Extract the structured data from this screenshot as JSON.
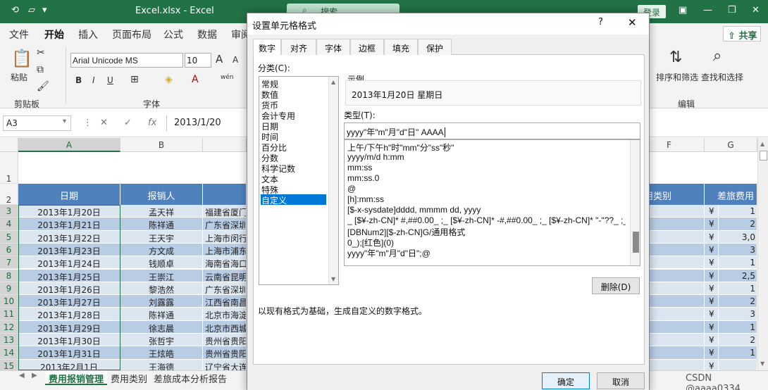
{
  "titlebar": {
    "title": "Excel.xlsx  -  Excel",
    "search_placeholder": "搜索",
    "login_label": "登录",
    "accent_color": "#217346"
  },
  "ribbon": {
    "tabs": [
      "文件",
      "开始",
      "插入",
      "页面布局",
      "公式",
      "数据",
      "审阅"
    ],
    "active_tab": "开始",
    "share_label": "共享",
    "clipboard": {
      "paste_label": "粘贴",
      "group_label": "剪贴板"
    },
    "font": {
      "name": "Arial Unicode MS",
      "size": "10",
      "group_label": "字体",
      "bold": "B",
      "italic": "I",
      "underline": "U",
      "grow": "A",
      "shrink": "A",
      "phonetic": "wén"
    },
    "editing": {
      "sort_label": "排序和筛选",
      "find_label": "查找和选择",
      "group_label": "编辑"
    }
  },
  "formula_bar": {
    "name_box": "A3",
    "fx_label": "fx",
    "formula": "2013/1/20"
  },
  "grid": {
    "columns": [
      "A",
      "B",
      "F",
      "G"
    ],
    "rows": [
      "1",
      "2",
      "3",
      "4",
      "5",
      "6",
      "7",
      "8",
      "9",
      "10",
      "11",
      "12",
      "13",
      "14",
      "15"
    ],
    "headers": {
      "date": "日期",
      "person": "报销人",
      "category": "用类别",
      "amount": "差旅费用"
    },
    "data_rows": [
      {
        "date": "2013年1月20日",
        "person": "孟天祥",
        "place": "福建省厦门",
        "cur": "¥",
        "amt": "1"
      },
      {
        "date": "2013年1月21日",
        "person": "陈祥通",
        "place": "广东省深圳",
        "cur": "¥",
        "amt": "2"
      },
      {
        "date": "2013年1月22日",
        "person": "王天宇",
        "place": "上海市闵行",
        "cur": "¥",
        "amt": "3,0"
      },
      {
        "date": "2013年1月23日",
        "person": "方文成",
        "place": "上海市浦东",
        "cur": "¥",
        "amt": "3"
      },
      {
        "date": "2013年1月24日",
        "person": "钱顺卓",
        "place": "海南省海口",
        "cur": "¥",
        "amt": "1"
      },
      {
        "date": "2013年1月25日",
        "person": "王崇江",
        "place": "云南省昆明",
        "cur": "¥",
        "amt": "2,5"
      },
      {
        "date": "2013年1月26日",
        "person": "黎浩然",
        "place": "广东省深圳",
        "cur": "¥",
        "amt": "1"
      },
      {
        "date": "2013年1月27日",
        "person": "刘露露",
        "place": "江西省南昌",
        "cur": "¥",
        "amt": "2"
      },
      {
        "date": "2013年1月28日",
        "person": "陈祥通",
        "place": "北京市海淀",
        "cur": "¥",
        "amt": "3"
      },
      {
        "date": "2013年1月29日",
        "person": "徐志晨",
        "place": "北京市西城",
        "cur": "¥",
        "amt": "1"
      },
      {
        "date": "2013年1月30日",
        "person": "张哲宇",
        "place": "贵州省贵阳",
        "cur": "¥",
        "amt": "2"
      },
      {
        "date": "2013年1月31日",
        "person": "王炫皓",
        "place": "贵州省贵阳",
        "cur": "¥",
        "amt": "1"
      },
      {
        "date": "2013年2月1日",
        "person": "王海德",
        "place": "辽宁省大连",
        "cur": "¥",
        "amt": ""
      }
    ],
    "header_color": "#4f81bd",
    "row_color_a": "#dce6f1",
    "row_color_b": "#b8cce4"
  },
  "sheets": {
    "tabs": [
      "费用报销管理",
      "费用类别",
      "差旅成本分析报告"
    ],
    "active": "费用报销管理"
  },
  "watermark": "CSDN @aaaa0334",
  "dialog": {
    "title": "设置单元格格式",
    "help": "?",
    "close": "✕",
    "tabs": [
      "数字",
      "对齐",
      "字体",
      "边框",
      "填充",
      "保护"
    ],
    "active_tab": "数字",
    "category_label": "分类(C):",
    "categories": [
      "常规",
      "数值",
      "货币",
      "会计专用",
      "日期",
      "时间",
      "百分比",
      "分数",
      "科学记数",
      "文本",
      "特殊",
      "自定义"
    ],
    "selected_category": "自定义",
    "sample_label": "示例",
    "sample_value": "2013年1月20日 星期日",
    "type_label": "类型(T):",
    "type_value": "yyyy\"年\"m\"月\"d\"日\" AAAA",
    "type_list": [
      "上午/下午h\"时\"mm\"分\"ss\"秒\"",
      "yyyy/m/d h:mm",
      "mm:ss",
      "mm:ss.0",
      "@",
      "[h]:mm:ss",
      "[$-x-sysdate]dddd, mmmm dd, yyyy",
      "_ [$¥-zh-CN]* #,##0.00_ ;_ [$¥-zh-CN]* -#,##0.00_ ;_ [$¥-zh-CN]* \"-\"??_ ;_ @_",
      "[DBNum2][$-zh-CN]G/通用格式",
      "0_);[红色](0)",
      "yyyy\"年\"m\"月\"d\"日\";@"
    ],
    "delete_label": "删除(D)",
    "note": "以现有格式为基础，生成自定义的数字格式。",
    "ok_label": "确定",
    "cancel_label": "取消"
  }
}
